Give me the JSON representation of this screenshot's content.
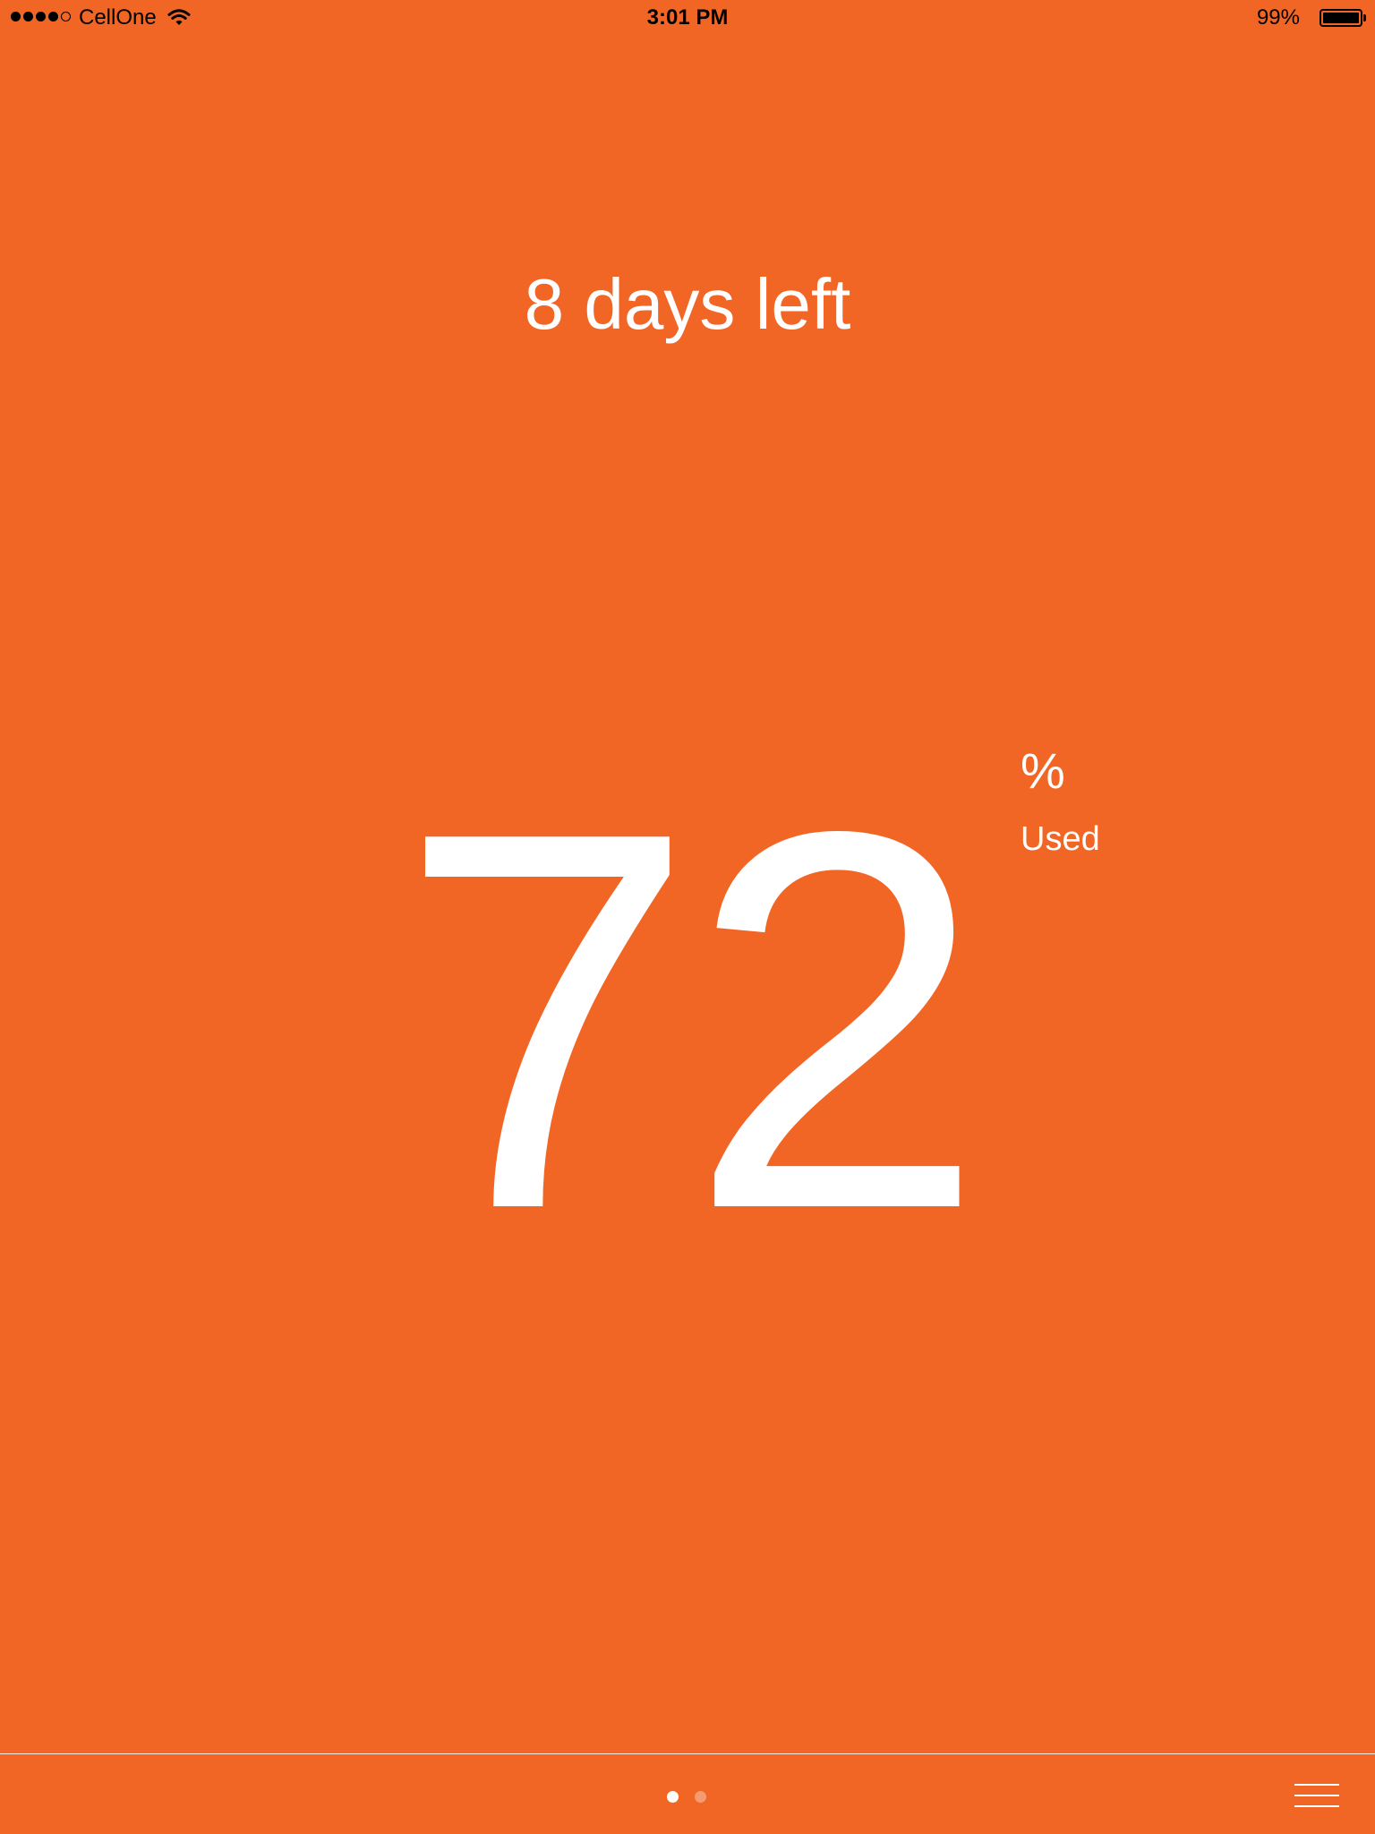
{
  "status_bar": {
    "signal_bars_filled": 4,
    "signal_bars_total": 5,
    "carrier": "CellOne",
    "wifi_icon": "wifi-icon",
    "time": "3:01 PM",
    "battery_percent_text": "99%",
    "battery_level": 0.99
  },
  "usage": {
    "days_left": "8 days left",
    "value": "72",
    "unit": "%",
    "label": "Used"
  },
  "pager": {
    "page_count": 2,
    "current_page": 1
  },
  "menu_icon": "hamburger-menu-icon",
  "colors": {
    "background": "#F26625",
    "foreground": "#FFFFFF"
  }
}
